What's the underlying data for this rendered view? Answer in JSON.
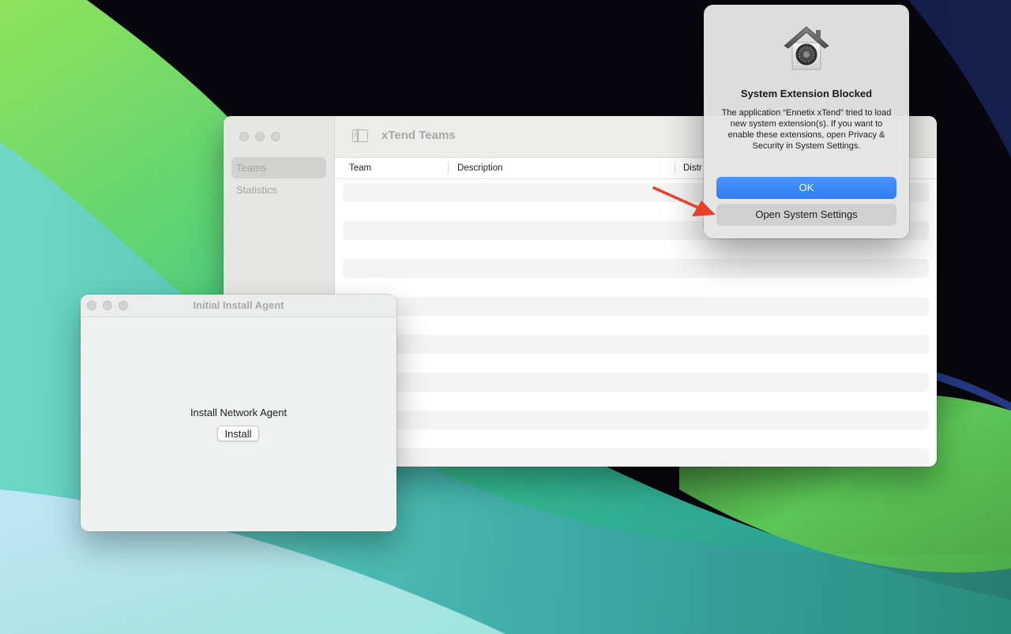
{
  "main_window": {
    "title": "xTend Teams",
    "sidebar": {
      "items": [
        {
          "label": "Teams",
          "selected": true
        },
        {
          "label": "Statistics",
          "selected": false
        }
      ]
    },
    "table": {
      "columns": [
        "Team",
        "Description",
        "Distr"
      ]
    }
  },
  "agent_window": {
    "title": "Initial Install Agent",
    "label": "Install Network Agent",
    "install_button": "Install"
  },
  "alert": {
    "icon": "security-house-icon",
    "title": "System Extension Blocked",
    "message": "The application “Ennetix xTend” tried to load new system extension(s). If you want to enable these extensions, open Privacy & Security in System Settings.",
    "ok_button": "OK",
    "settings_button": "Open System Settings"
  },
  "colors": {
    "accent": "#2f7cf6",
    "annotation_arrow": "#e8402a"
  }
}
